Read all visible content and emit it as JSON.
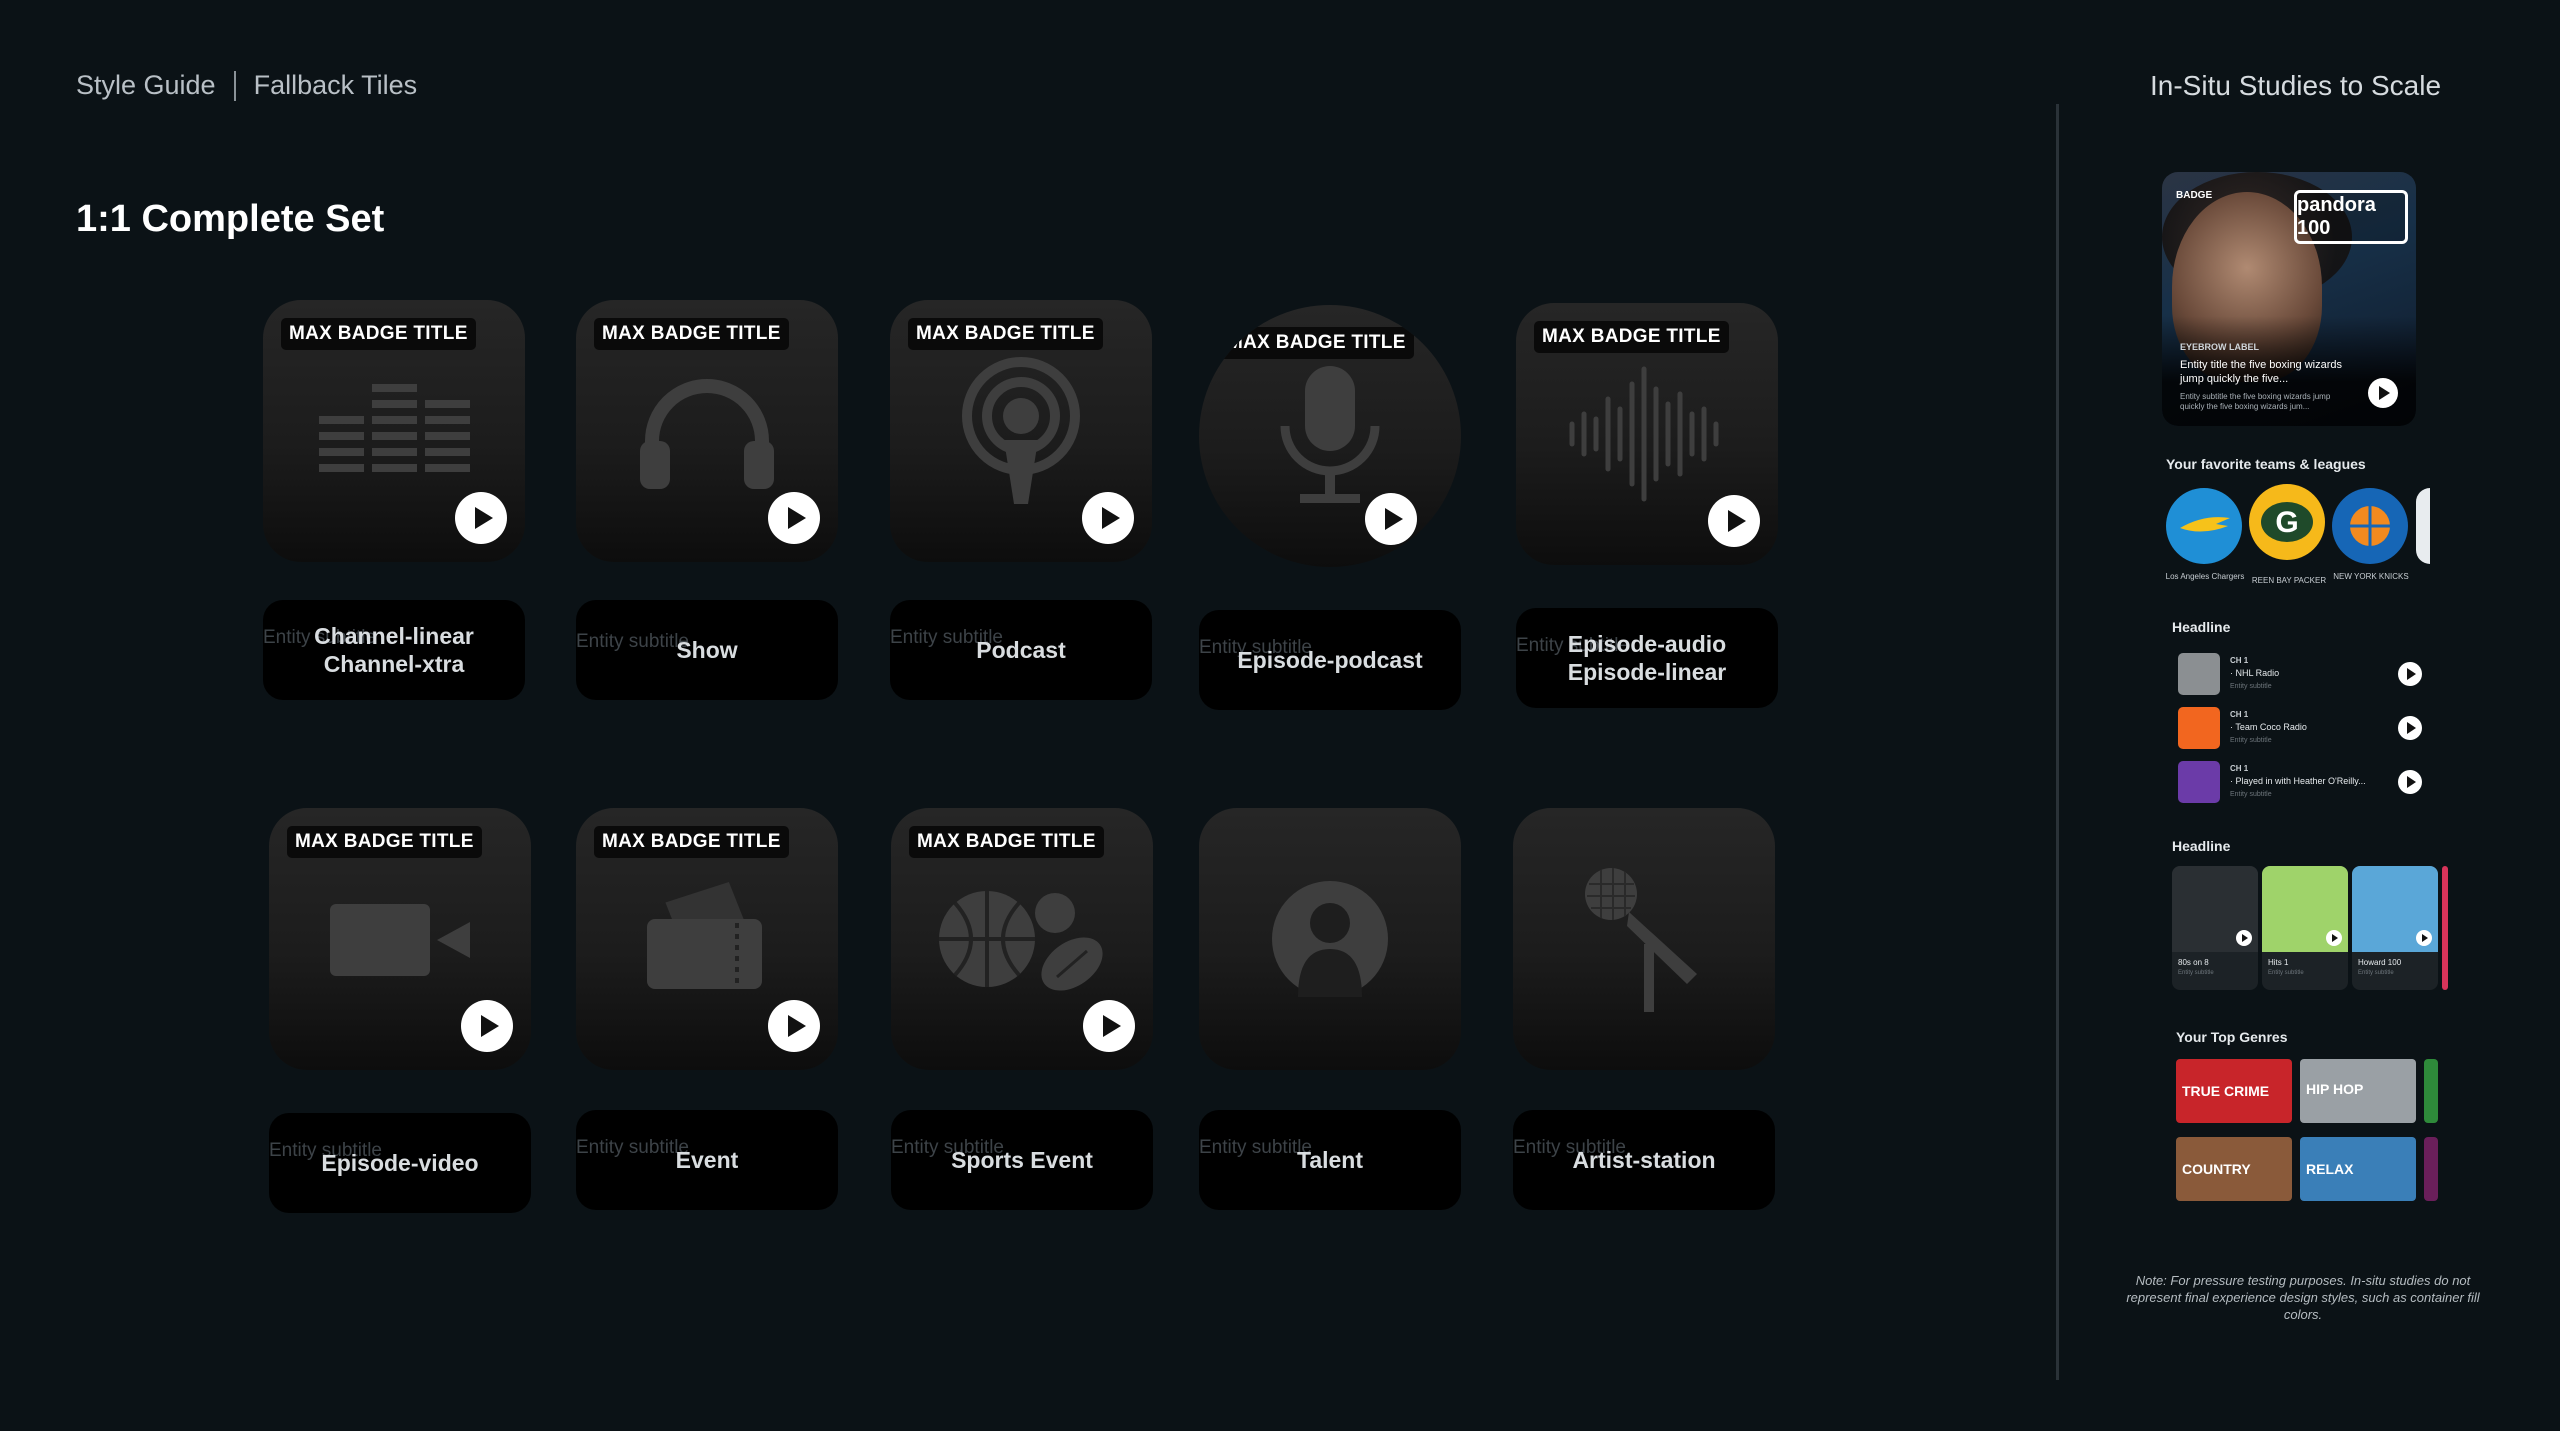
{
  "header": {
    "style_guide": "Style Guide",
    "page_name": "Fallback Tiles",
    "right_title": "In-Situ Studies to Scale"
  },
  "section_title": "1:1 Complete Set",
  "tiles": [
    {
      "badge": "MAX BADGE TITLE",
      "ghost": "Entity subtitle",
      "label": "Channel-linear\nChannel-xtra",
      "icon": "equalizer-icon"
    },
    {
      "badge": "MAX BADGE TITLE",
      "ghost": "Entity subtitle",
      "label": "Show",
      "icon": "headphones-icon"
    },
    {
      "badge": "MAX BADGE TITLE",
      "ghost": "Entity subtitle",
      "label": "Podcast",
      "icon": "podcast-icon"
    },
    {
      "badge": "MAX BADGE TITLE",
      "ghost": "Entity subtitle",
      "label": "Episode-podcast",
      "icon": "microphone-icon"
    },
    {
      "badge": "MAX BADGE TITLE",
      "ghost": "Entity subtitle",
      "label": "Episode-audio\nEpisode-linear",
      "icon": "waveform-icon"
    },
    {
      "badge": "MAX BADGE TITLE",
      "ghost": "Entity subtitle",
      "label": "Episode-video",
      "icon": "video-camera-icon"
    },
    {
      "badge": "MAX BADGE TITLE",
      "ghost": "Entity subtitle",
      "label": "Event",
      "icon": "tickets-icon"
    },
    {
      "badge": "MAX BADGE TITLE",
      "ghost": "Entity subtitle",
      "label": "Sports Event",
      "icon": "sports-balls-icon"
    },
    {
      "badge": "",
      "ghost": "Entity subtitle",
      "label": "Talent",
      "icon": "person-icon"
    },
    {
      "badge": "",
      "ghost": "Entity subtitle",
      "label": "Artist-station",
      "icon": "stage-microphone-icon"
    }
  ],
  "hero": {
    "badge": "BADGE",
    "logo": "pandora 100",
    "eyebrow": "EYEBROW LABEL",
    "title": "Entity title the five boxing wizards jump quickly the five...",
    "subtitle": "Entity subtitle the five boxing wizards jump quickly the five boxing wizards jum..."
  },
  "teams": {
    "heading": "Your favorite teams & leagues",
    "items": [
      {
        "name": "Los Angeles Chargers",
        "color": "#1f8fd6"
      },
      {
        "name": "REEN BAY PACKER",
        "color": "#f6b91a"
      },
      {
        "name": "NEW YORK KNICKS",
        "color": "#1666b6"
      }
    ]
  },
  "list_section": {
    "heading": "Headline",
    "rows": [
      {
        "ch": "CH 1",
        "title": "· NHL Radio",
        "sub": "Entity subtitle",
        "color": "#8b8f92"
      },
      {
        "ch": "CH 1",
        "title": "· Team Coco Radio",
        "sub": "Entity subtitle",
        "color": "#f2661f"
      },
      {
        "ch": "CH 1",
        "title": "· Played in with Heather O'Reilly...",
        "sub": "Entity subtitle",
        "color": "#6b3ba8"
      }
    ]
  },
  "carousel": {
    "heading": "Headline",
    "items": [
      {
        "title": "80s on 8",
        "sub": "Entity subtitle",
        "color": "#2a2f33"
      },
      {
        "title": "Hits 1",
        "sub": "Entity subtitle",
        "color": "#9fd36a"
      },
      {
        "title": "Howard 100",
        "sub": "Entity subtitle",
        "color": "#5aa7d8"
      }
    ]
  },
  "genres": {
    "heading": "Your Top Genres",
    "items": [
      {
        "name": "TRUE CRIME",
        "color": "#c8252a"
      },
      {
        "name": "HIP HOP",
        "color": "#9aa0a5"
      },
      {
        "name": "COUNTRY",
        "color": "#8a5a3a"
      },
      {
        "name": "RELAX",
        "color": "#3a7fb8"
      }
    ]
  },
  "note": "Note: For pressure testing purposes. In-situ studies do not represent final experience design styles, such as container fill colors."
}
